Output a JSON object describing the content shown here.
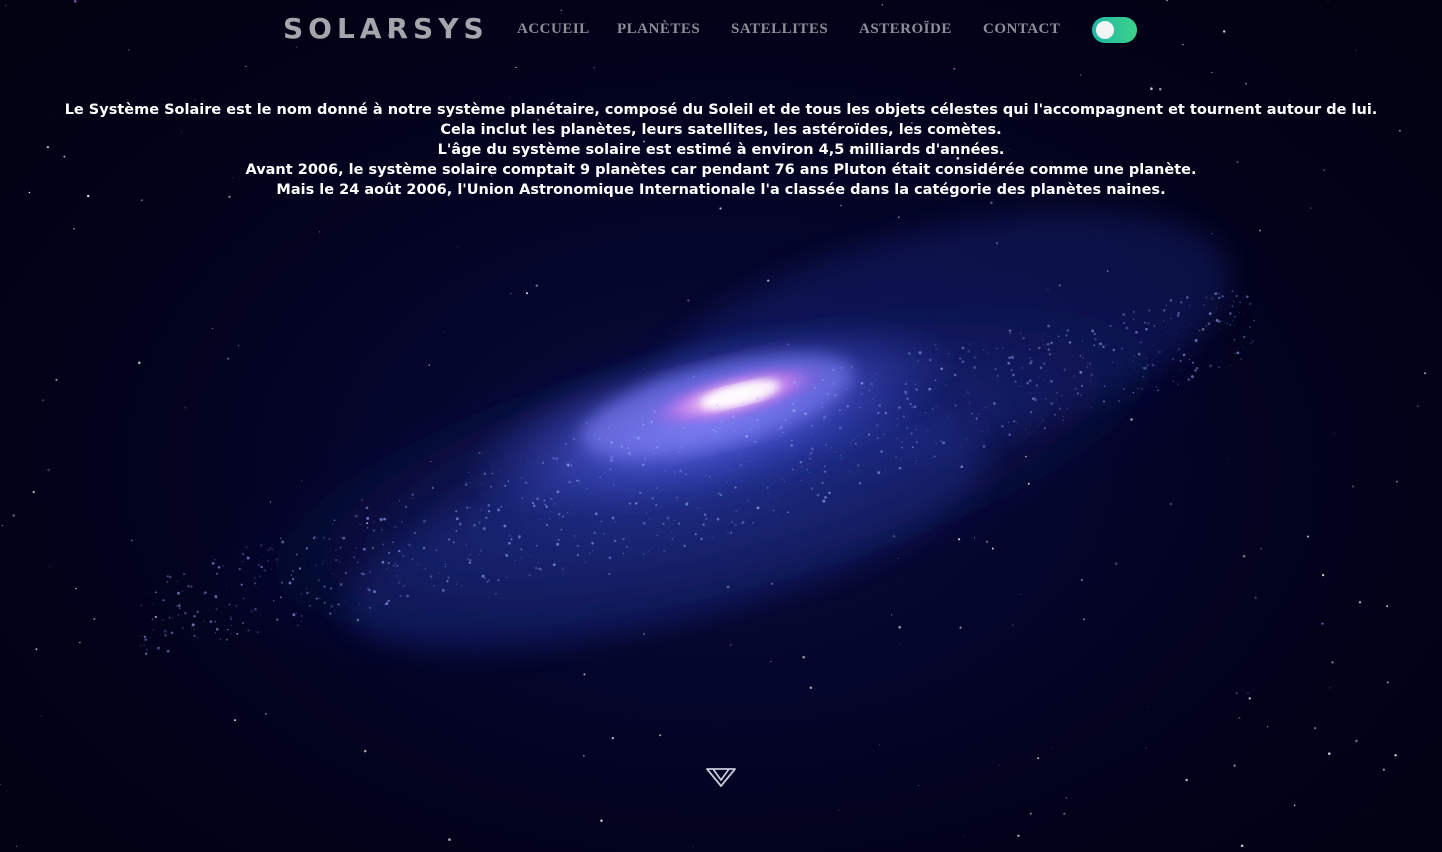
{
  "brand": {
    "logo": "SOLARSYS"
  },
  "nav": {
    "items": [
      {
        "label": "ACCUEIL"
      },
      {
        "label": "PLANÈTES"
      },
      {
        "label": "SATELLITES"
      },
      {
        "label": "ASTEROÏDE"
      },
      {
        "label": "CONTACT"
      }
    ],
    "theme_toggle": {
      "state": "on",
      "icon": "toggle-switch-icon",
      "color": "#2ec79a"
    }
  },
  "intro": {
    "lines": [
      "Le Système Solaire est le nom donné à notre système planétaire, composé du Soleil et de tous les objets célestes qui l'accompagnent et tournent autour de lui.",
      "Cela inclut les planètes, leurs satellites, les astéroïdes, les comètes.",
      "L'âge du système solaire est estimé à environ 4,5 milliards d'années.",
      "Avant 2006, le système solaire comptait 9 planètes car pendant 76 ans Pluton était considérée comme une planète.",
      "Mais le 24 août 2006, l'Union Astronomique Internationale l'a classée dans la catégorie des planètes naines."
    ]
  },
  "hero": {
    "background_icon": "galaxy-image"
  },
  "scroll": {
    "icon": "chevron-down-icon"
  }
}
